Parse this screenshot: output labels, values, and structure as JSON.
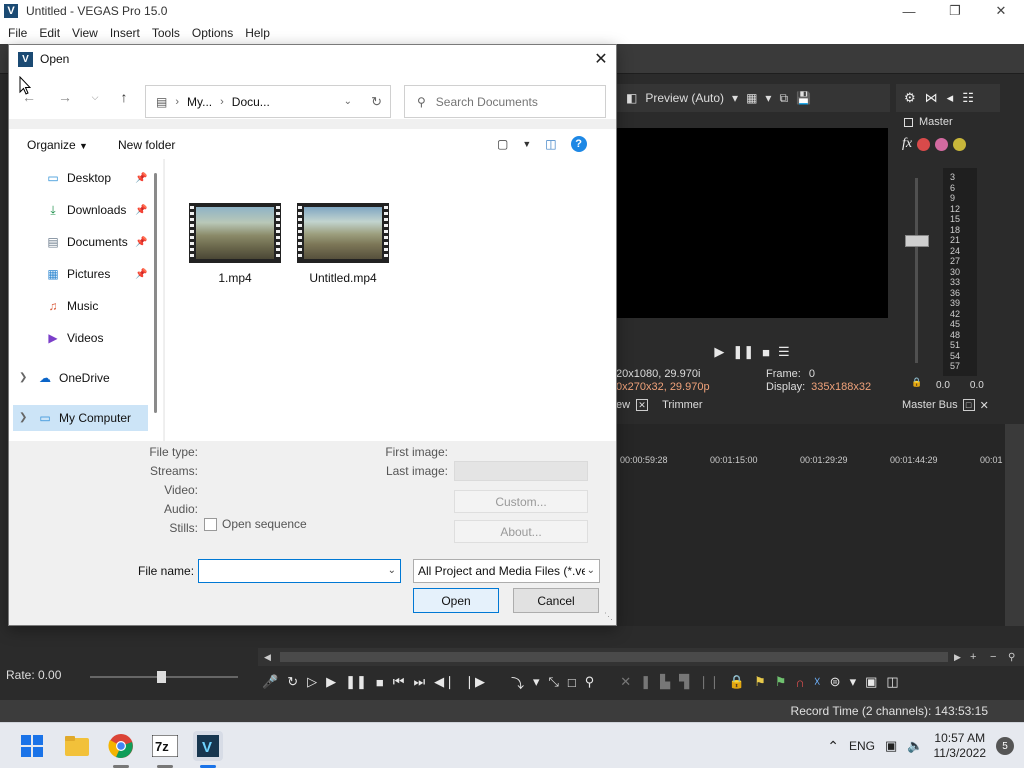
{
  "app": {
    "title": "Untitled - VEGAS Pro 15.0",
    "menu": [
      "File",
      "Edit",
      "View",
      "Insert",
      "Tools",
      "Options",
      "Help"
    ]
  },
  "preview": {
    "mode_label": "Preview (Auto)",
    "project_line": "20x1080, 29.970i",
    "preview_line": "0x270x32, 29.970p",
    "frame_label": "Frame:",
    "frame_value": "0",
    "display_label": "Display:",
    "display_value": "335x188x32",
    "tab_view": "ew",
    "tab_trimmer": "Trimmer"
  },
  "master": {
    "label": "Master",
    "scale": [
      "3",
      "6",
      "9",
      "12",
      "15",
      "18",
      "21",
      "24",
      "27",
      "30",
      "33",
      "36",
      "39",
      "42",
      "45",
      "48",
      "51",
      "54",
      "57"
    ],
    "left_value": "0.0",
    "right_value": "0.0",
    "bus_tab": "Master Bus"
  },
  "timeline": {
    "ruler": [
      "00:00:59:28",
      "00:01:15:00",
      "00:01:29:29",
      "00:01:44:29",
      "00:01"
    ]
  },
  "transport": {
    "rate_label": "Rate: 0.00"
  },
  "status": {
    "record_time": "Record Time (2 channels): 143:53:15"
  },
  "taskbar": {
    "language": "ENG",
    "time": "10:57 AM",
    "date": "11/3/2022",
    "notification_count": "5"
  },
  "dialog": {
    "title": "Open",
    "close_glyph": "✕",
    "address": {
      "crumb1": "My...",
      "crumb2": "Docu..."
    },
    "search_placeholder": "Search Documents",
    "organize_label": "Organize",
    "new_folder_label": "New folder",
    "nav_items": [
      {
        "label": "Desktop",
        "icon": "desktop-icon"
      },
      {
        "label": "Downloads",
        "icon": "download-icon"
      },
      {
        "label": "Documents",
        "icon": "document-icon"
      },
      {
        "label": "Pictures",
        "icon": "pictures-icon"
      },
      {
        "label": "Music",
        "icon": "music-icon"
      },
      {
        "label": "Videos",
        "icon": "videos-icon"
      },
      {
        "label": "OneDrive",
        "icon": "cloud-icon"
      },
      {
        "label": "My Computer",
        "icon": "computer-icon"
      }
    ],
    "files": [
      {
        "name": "1.mp4"
      },
      {
        "name": "Untitled.mp4"
      }
    ],
    "info": {
      "file_type": "File type:",
      "streams": "Streams:",
      "video": "Video:",
      "audio": "Audio:",
      "stills": "Stills:",
      "open_sequence": "Open sequence",
      "first_image": "First image:",
      "last_image": "Last image:",
      "custom_button": "Custom...",
      "about_button": "About..."
    },
    "file_name_label": "File name:",
    "file_name_value": "",
    "file_type_filter": "All Project and Media Files (*.ve",
    "open_button": "Open",
    "cancel_button": "Cancel"
  }
}
